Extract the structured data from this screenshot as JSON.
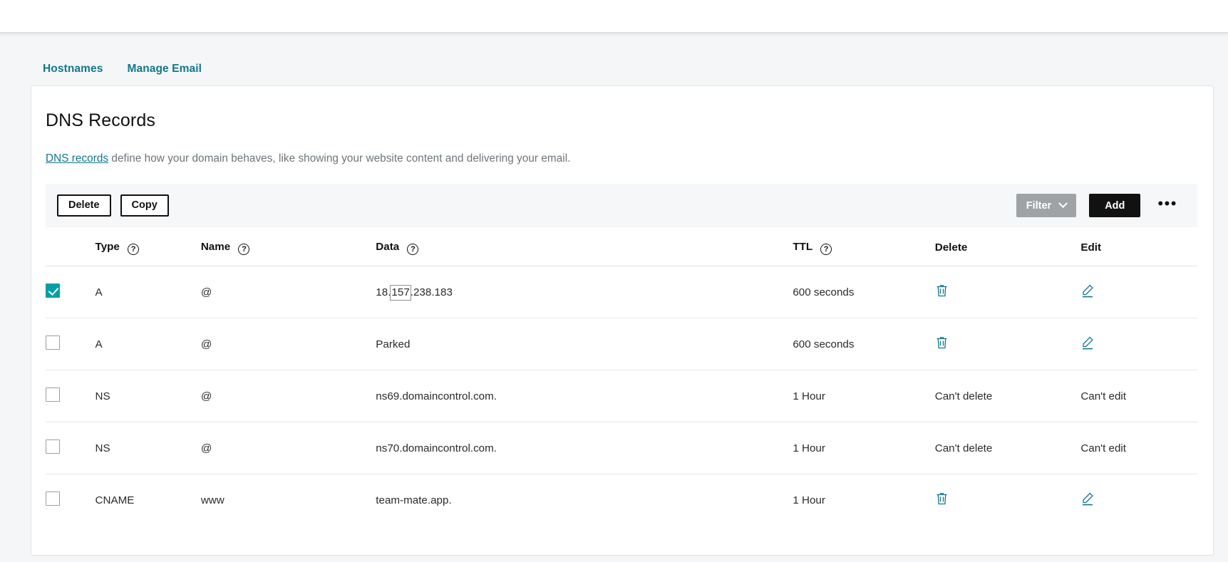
{
  "subnav": {
    "items": [
      {
        "label": "Hostnames"
      },
      {
        "label": "Manage Email"
      }
    ]
  },
  "card": {
    "title": "DNS Records",
    "description_link": "DNS records",
    "description_rest": " define how your domain behaves, like showing your website content and delivering your email."
  },
  "toolbar": {
    "delete_label": "Delete",
    "copy_label": "Copy",
    "filter_label": "Filter",
    "add_label": "Add",
    "more_label": "•••"
  },
  "table": {
    "headers": {
      "type": "Type",
      "name": "Name",
      "data": "Data",
      "ttl": "TTL",
      "delete": "Delete",
      "edit": "Edit"
    },
    "rows": [
      {
        "selected": true,
        "type": "A",
        "name": "@",
        "data_pre": "18.",
        "data_highlight": "157",
        "data_post": ".238.183",
        "ttl": "600 seconds",
        "delete": "trash-icon",
        "edit": "pencil-icon"
      },
      {
        "selected": false,
        "type": "A",
        "name": "@",
        "data": "Parked",
        "ttl": "600 seconds",
        "delete": "trash-icon",
        "edit": "pencil-icon"
      },
      {
        "selected": false,
        "type": "NS",
        "name": "@",
        "data": "ns69.domaincontrol.com.",
        "ttl": "1 Hour",
        "delete": "Can't delete",
        "edit": "Can't edit"
      },
      {
        "selected": false,
        "type": "NS",
        "name": "@",
        "data": "ns70.domaincontrol.com.",
        "ttl": "1 Hour",
        "delete": "Can't delete",
        "edit": "Can't edit"
      },
      {
        "selected": false,
        "type": "CNAME",
        "name": "www",
        "data": "team-mate.app.",
        "ttl": "1 Hour",
        "delete": "trash-icon",
        "edit": "pencil-icon"
      }
    ]
  },
  "colors": {
    "accent_teal": "#10788b",
    "checkbox_teal": "#03a0a8",
    "page_bg": "#f5f6f7",
    "toolbar_bg": "#f6f7f8",
    "filter_disabled": "#9fa3a6",
    "add_bg": "#111111"
  }
}
